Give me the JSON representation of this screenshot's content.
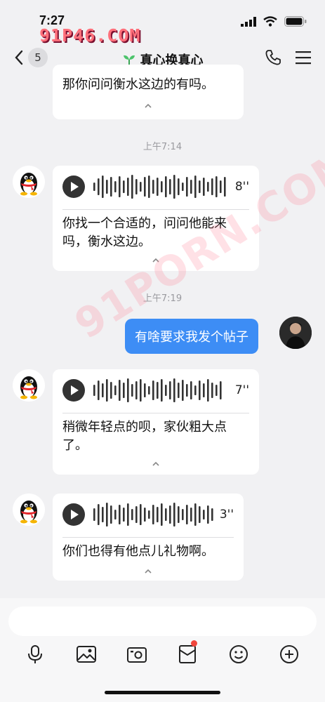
{
  "status": {
    "time": "7:27"
  },
  "watermark": {
    "top": "91P46.COM",
    "diagonal": "91PORN.COM"
  },
  "nav": {
    "back_count": "5",
    "title": "真心换真心"
  },
  "messages": [
    {
      "kind": "text-card",
      "text": "那你问问衡水这边的有吗。"
    },
    {
      "kind": "timestamp",
      "text": "上午7:14"
    },
    {
      "kind": "voice",
      "duration": "8''",
      "transcript": "你找一个合适的，问问他能来吗，衡水这边。"
    },
    {
      "kind": "timestamp",
      "text": "上午7:19"
    },
    {
      "kind": "mine",
      "text": "有啥要求我发个帖子"
    },
    {
      "kind": "voice",
      "duration": "7''",
      "transcript": "稍微年轻点的呗，家伙粗大点了。"
    },
    {
      "kind": "voice",
      "duration": "3''",
      "transcript": "你们也得有他点儿礼物啊。"
    }
  ],
  "toolbar": [
    "mic-icon",
    "image-icon",
    "camera-icon",
    "red-packet-icon",
    "emoji-icon",
    "plus-icon"
  ],
  "colors": {
    "accent": "#3d8df5",
    "badge_red": "#f0463c",
    "watermark": "#ff6f7a"
  }
}
